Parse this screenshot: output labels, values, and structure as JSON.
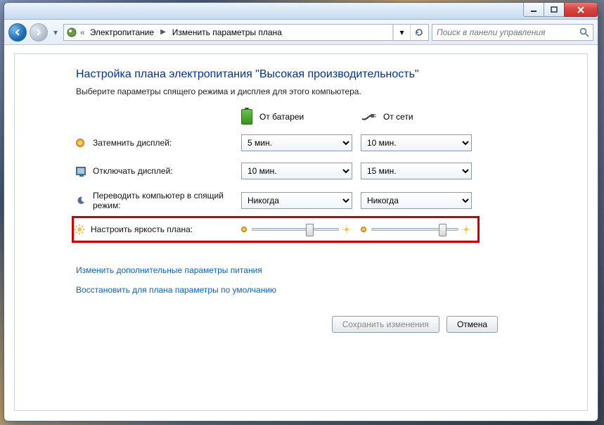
{
  "breadcrumb": {
    "level1": "Электропитание",
    "level2": "Изменить параметры плана"
  },
  "search": {
    "placeholder": "Поиск в панели управления"
  },
  "heading": "Настройка плана электропитания \"Высокая производительность\"",
  "subheading": "Выберите параметры спящего режима и дисплея для этого компьютера.",
  "columns": {
    "battery": "От батареи",
    "ac": "От сети"
  },
  "rows": {
    "dim": {
      "label": "Затемнить дисплей:",
      "battery": "5 мин.",
      "ac": "10 мин."
    },
    "off": {
      "label": "Отключать дисплей:",
      "battery": "10 мин.",
      "ac": "15 мин."
    },
    "sleep": {
      "label": "Переводить компьютер в спящий режим:",
      "battery": "Никогда",
      "ac": "Никогда"
    },
    "bright": {
      "label": "Настроить яркость плана:"
    }
  },
  "links": {
    "advanced": "Изменить дополнительные параметры питания",
    "restore": "Восстановить для плана параметры по умолчанию"
  },
  "buttons": {
    "save": "Сохранить изменения",
    "cancel": "Отмена"
  }
}
